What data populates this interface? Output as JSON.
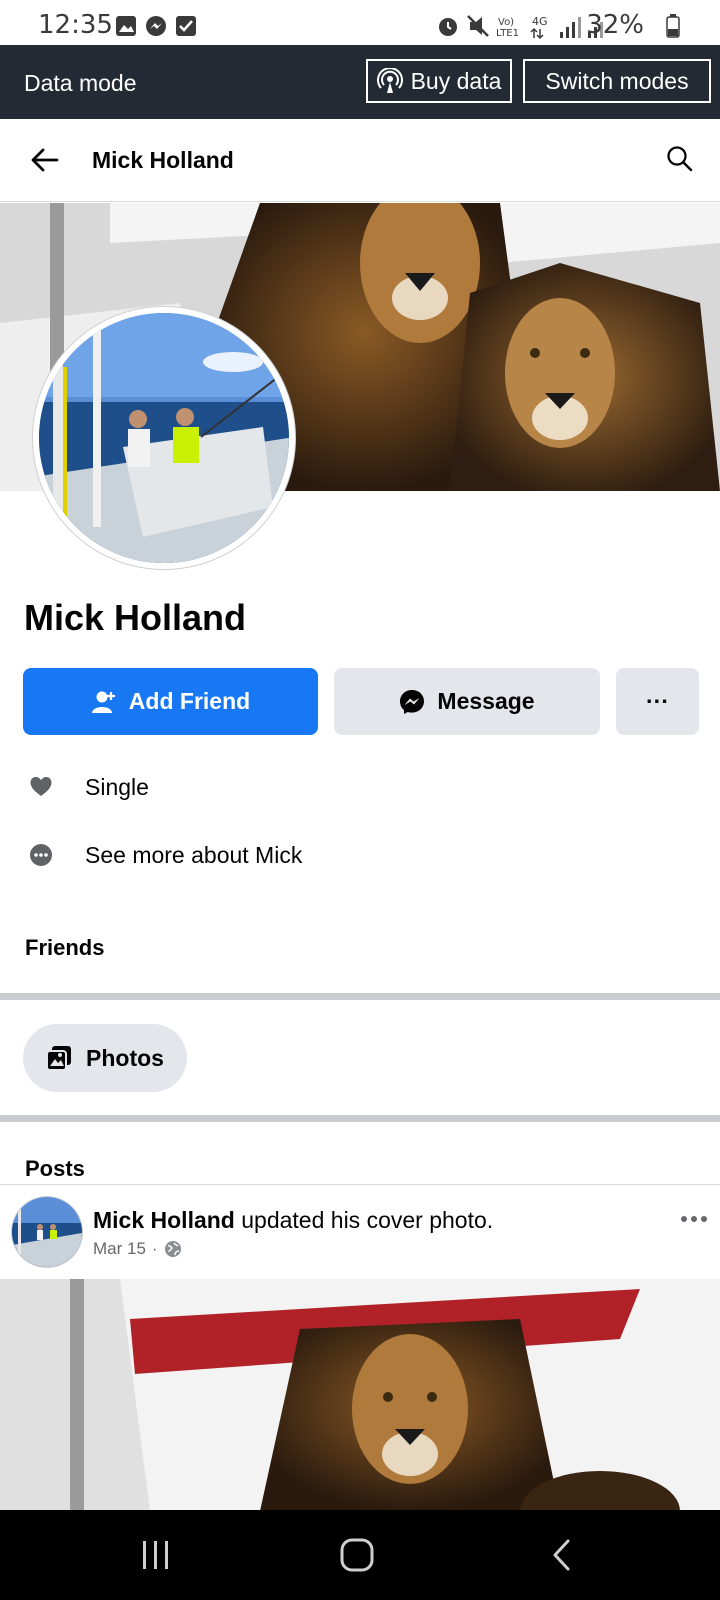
{
  "status_bar": {
    "time": "12:35",
    "battery": "32%"
  },
  "data_mode": {
    "title": "Data mode",
    "buy_label": "Buy data",
    "switch_label": "Switch modes"
  },
  "header": {
    "title": "Mick Holland"
  },
  "profile": {
    "name": "Mick Holland",
    "add_friend_label": "Add Friend",
    "message_label": "Message",
    "more_label": "···",
    "info": [
      {
        "icon": "heart-icon",
        "text": "Single"
      },
      {
        "icon": "more-circle-icon",
        "text": "See more about Mick"
      }
    ]
  },
  "sections": {
    "friends": "Friends",
    "photos": "Photos",
    "posts": "Posts"
  },
  "post": {
    "author": "Mick Holland",
    "action": " updated his cover photo.",
    "date": "Mar 15",
    "separator": "·",
    "privacy_icon": "globe-icon"
  },
  "colors": {
    "accent": "#1877f2",
    "data_bar": "#242a33",
    "button_gray": "#e4e6eb"
  }
}
